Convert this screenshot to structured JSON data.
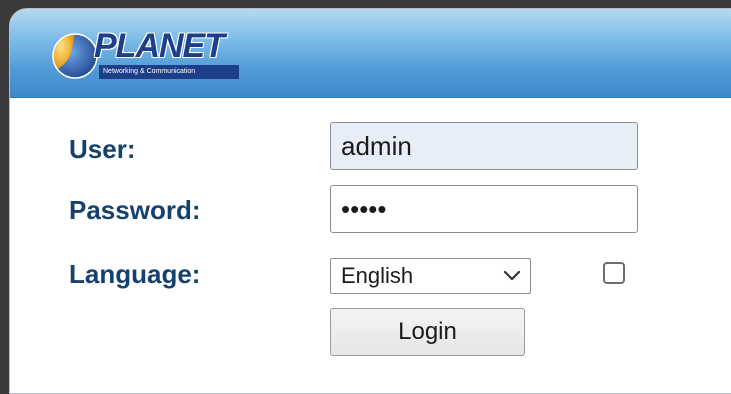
{
  "brand": {
    "name": "PLANET",
    "tagline": "Networking & Communication",
    "logo_icon": "globe-icon"
  },
  "form": {
    "user_label": "User:",
    "user_value": "admin",
    "password_label": "Password:",
    "password_value": "•••••",
    "language_label": "Language:",
    "language_selected": "English",
    "language_arrow_icon": "chevron-down-icon",
    "remember_checkbox_checked": false,
    "login_label": "Login"
  },
  "colors": {
    "label": "#16416e",
    "header_blue": "#4f9ad6",
    "brand_navy": "#1d3f8a"
  }
}
